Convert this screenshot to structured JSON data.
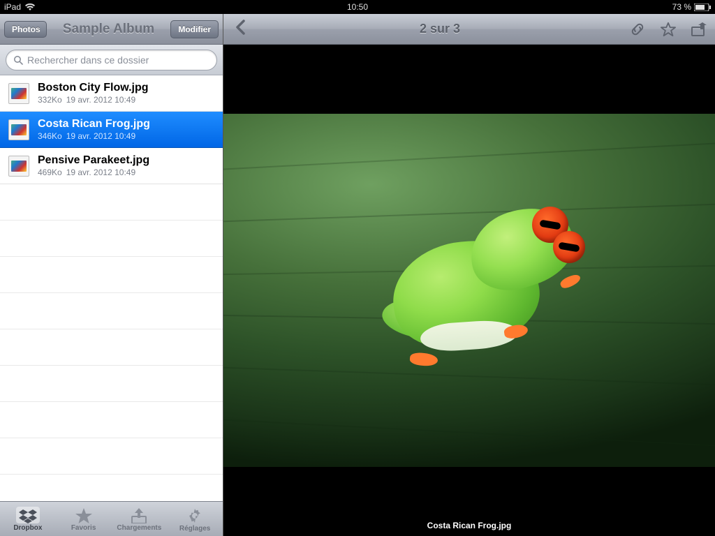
{
  "status": {
    "device": "iPad",
    "time": "10:50",
    "battery": "73 %"
  },
  "sidebar": {
    "back_label": "Photos",
    "title": "Sample Album",
    "edit_label": "Modifier",
    "search_placeholder": "Rechercher dans ce dossier",
    "files": [
      {
        "name": "Boston City Flow.jpg",
        "size": "332Ko",
        "date": "19 avr. 2012 10:49",
        "selected": false
      },
      {
        "name": "Costa Rican Frog.jpg",
        "size": "346Ko",
        "date": "19 avr. 2012 10:49",
        "selected": true
      },
      {
        "name": "Pensive Parakeet.jpg",
        "size": "469Ko",
        "date": "19 avr. 2012 10:49",
        "selected": false
      }
    ],
    "tabs": [
      {
        "label": "Dropbox",
        "active": true
      },
      {
        "label": "Favoris",
        "active": false
      },
      {
        "label": "Chargements",
        "active": false
      },
      {
        "label": "Réglages",
        "active": false
      }
    ]
  },
  "preview": {
    "title": "2 sur 3",
    "caption": "Costa Rican Frog.jpg"
  }
}
